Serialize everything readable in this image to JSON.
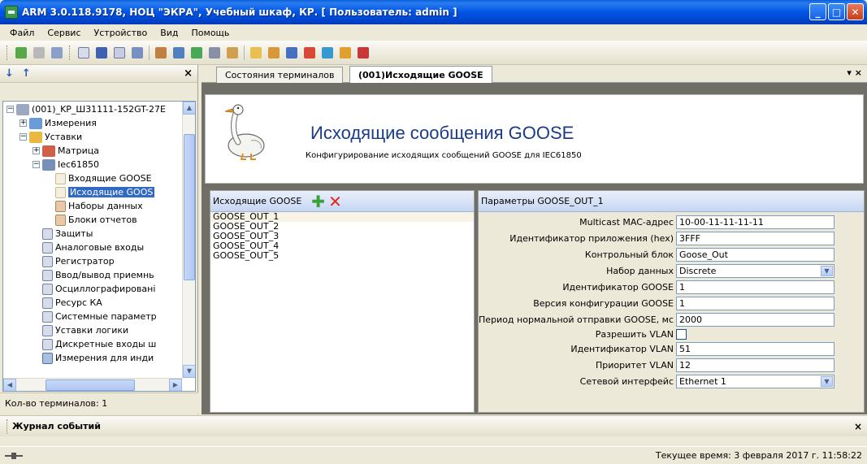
{
  "window": {
    "title": "ARM 3.0.118.9178, НОЦ \"ЭКРА\", Учебный шкаф, КР. [ Пользователь: admin ]"
  },
  "menu": [
    "Файл",
    "Сервис",
    "Устройство",
    "Вид",
    "Помощь"
  ],
  "left": {
    "footer": "Кол-во терминалов: 1",
    "tree": [
      "(001)_KP_Ш31111-152GT-27E",
      "Измерения",
      "Уставки",
      "Матрица",
      "Iec61850",
      "Входящие GOOSE",
      "Исходящие GOOS",
      "Наборы данных",
      "Блоки отчетов",
      "Защиты",
      "Аналоговые входы",
      "Регистратор",
      "Ввод/вывод приемнь",
      "Осциллографировані",
      "Ресурс КА",
      "Системные параметр",
      "Уставки логики",
      "Дискретные входы ш",
      "Измерения для инди"
    ]
  },
  "tabs": [
    "Состояния терминалов",
    "(001)Исходящие GOOSE"
  ],
  "banner": {
    "title": "Исходящие сообщения GOOSE",
    "subtitle": "Конфигурирование исходящих сообщений GOOSE для IEC61850"
  },
  "goose_list": {
    "header": "Исходящие GOOSE",
    "items": [
      "GOOSE_OUT_1",
      "GOOSE_OUT_2",
      "GOOSE_OUT_3",
      "GOOSE_OUT_4",
      "GOOSE_OUT_5"
    ]
  },
  "params": {
    "header": "Параметры GOOSE_OUT_1",
    "rows": [
      {
        "label": "Multicast MAC-адрес",
        "value": "10-00-11-11-11-11"
      },
      {
        "label": "Идентификатор приложения (hex)",
        "value": "3FFF"
      },
      {
        "label": "Контрольный блок",
        "value": "Goose_Out"
      },
      {
        "label": "Набор данных",
        "value": "Discrete"
      },
      {
        "label": "Идентификатор GOOSE",
        "value": "1"
      },
      {
        "label": "Версия конфигурации GOOSE",
        "value": "1"
      },
      {
        "label": "Период нормальной отправки GOOSE, мс",
        "value": "2000"
      },
      {
        "label": "Разрешить VLAN",
        "value": ""
      },
      {
        "label": "Идентификатор VLAN",
        "value": "51"
      },
      {
        "label": "Приоритет VLAN",
        "value": "12"
      },
      {
        "label": "Сетевой интерфейс",
        "value": "Ethernet 1"
      }
    ]
  },
  "journal": {
    "title": "Журнал событий"
  },
  "status": {
    "time": "Текущее время: 3 февраля 2017 г. 11:58:22"
  }
}
